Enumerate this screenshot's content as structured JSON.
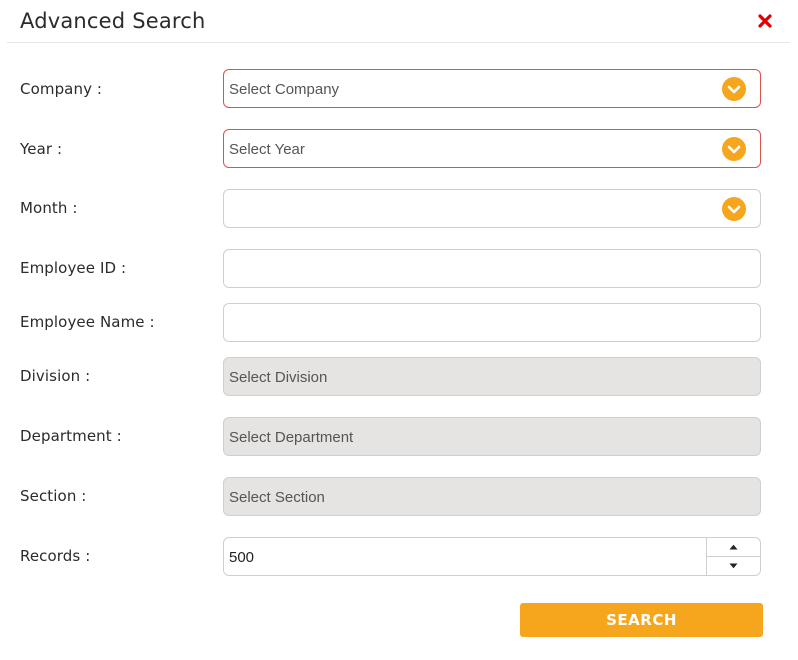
{
  "modal": {
    "title": "Advanced Search",
    "close_icon": "close-icon",
    "close_color": "#e00000"
  },
  "form": {
    "company": {
      "label": "Company :",
      "placeholder": "Select Company",
      "required": true
    },
    "year": {
      "label": "Year :",
      "placeholder": "Select Year",
      "required": true
    },
    "month": {
      "label": "Month :",
      "placeholder": ""
    },
    "employee_id": {
      "label": "Employee ID :",
      "value": ""
    },
    "employee_name": {
      "label": "Employee Name :",
      "value": ""
    },
    "division": {
      "label": "Division :",
      "placeholder": "Select Division",
      "disabled": true
    },
    "department": {
      "label": "Department :",
      "placeholder": "Select Department",
      "disabled": true
    },
    "section": {
      "label": "Section :",
      "placeholder": "Select Section",
      "disabled": true
    },
    "records": {
      "label": "Records :",
      "value": "500"
    }
  },
  "search_button": {
    "label": "SEARCH"
  },
  "colors": {
    "accent": "#f5a61d",
    "required_border": "#d9534f",
    "disabled_bg": "#e6e3e3"
  },
  "icons": {
    "dropdown": "chevron-down-icon",
    "spinner_up": "caret-up-icon",
    "spinner_down": "caret-down-icon"
  }
}
